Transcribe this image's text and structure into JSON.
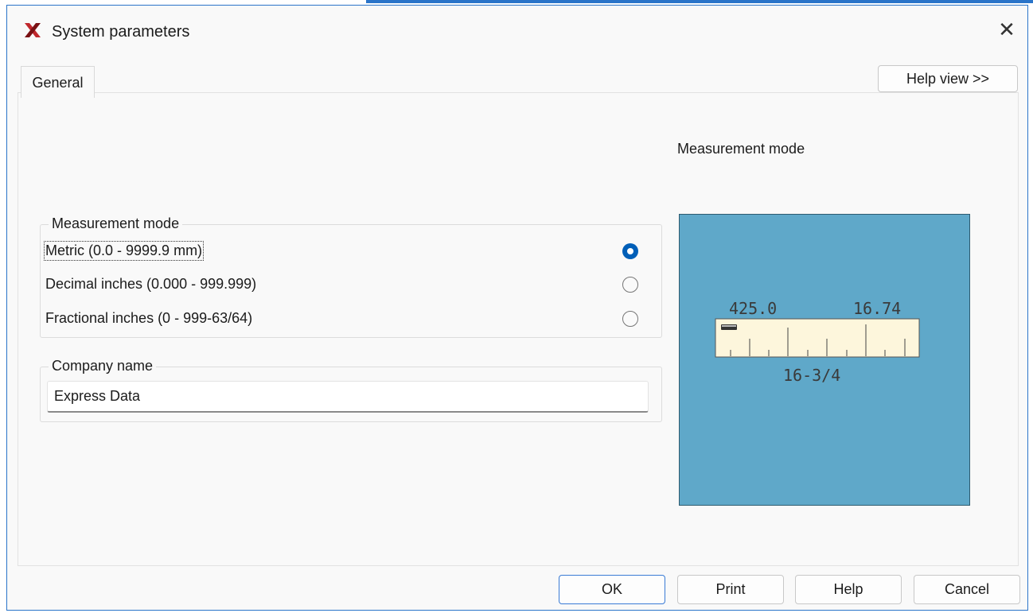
{
  "window": {
    "title": "System parameters",
    "close_glyph": "✕",
    "accent_color": "#2a74c9"
  },
  "tabs": [
    {
      "label": "General"
    }
  ],
  "help_view_label": "Help view >>",
  "measurement_group": {
    "legend": "Measurement mode",
    "options": [
      {
        "label": "Metric (0.0 - 9999.9 mm)",
        "selected": true
      },
      {
        "label": "Decimal inches (0.000 - 999.999)",
        "selected": false
      },
      {
        "label": "Fractional inches (0 - 999-63/64)",
        "selected": false
      }
    ]
  },
  "company_group": {
    "legend": "Company name",
    "value": "Express Data"
  },
  "help_panel": {
    "caption": "Measurement mode",
    "background_color": "#5fa8c9",
    "readouts": {
      "metric": "425.0",
      "decimal": "16.74",
      "fraction": "16-3/4"
    }
  },
  "buttons": {
    "ok": "OK",
    "print": "Print",
    "help": "Help",
    "cancel": "Cancel"
  }
}
